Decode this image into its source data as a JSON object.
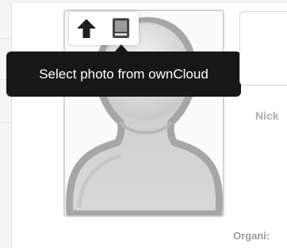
{
  "photo": {
    "placeholder_icon": "avatar-silhouette-icon",
    "actions": {
      "upload_icon": "upload-arrow-icon",
      "select_icon": "owncloud-folder-icon"
    }
  },
  "tooltip": {
    "text": "Select photo from ownCloud"
  },
  "fields": {
    "nickname_label": "Nick",
    "organization_label": "Organi:"
  },
  "colors": {
    "tooltip_bg": "#171717",
    "silhouette_fill": "#d0d0d0",
    "silhouette_stroke": "#a6a6a6",
    "label_text": "#aeaeae"
  }
}
